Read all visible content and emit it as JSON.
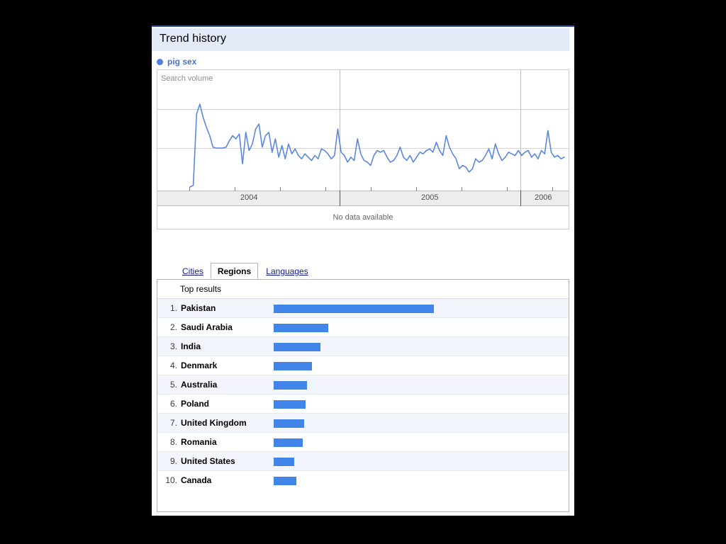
{
  "header": {
    "title": "Trend history"
  },
  "legend": {
    "dot_icon": "legend-dot-icon",
    "label": "pig sex",
    "color": "#4f7fe0"
  },
  "chart_panel": {
    "ylabel": "Search volume",
    "nodata_text": "No data available"
  },
  "tabs": [
    {
      "label": "Cities",
      "active": false
    },
    {
      "label": "Regions",
      "active": true
    },
    {
      "label": "Languages",
      "active": false
    }
  ],
  "results": {
    "header": "Top results",
    "rows": [
      {
        "rank": "1.",
        "name": "Pakistan",
        "value": 100
      },
      {
        "rank": "2.",
        "name": "Saudi Arabia",
        "value": 34
      },
      {
        "rank": "3.",
        "name": "India",
        "value": 29
      },
      {
        "rank": "4.",
        "name": "Denmark",
        "value": 24
      },
      {
        "rank": "5.",
        "name": "Australia",
        "value": 21
      },
      {
        "rank": "6.",
        "name": "Poland",
        "value": 20
      },
      {
        "rank": "7.",
        "name": "United Kingdom",
        "value": 19
      },
      {
        "rank": "8.",
        "name": "Romania",
        "value": 18
      },
      {
        "rank": "9.",
        "name": "United States",
        "value": 13
      },
      {
        "rank": "10.",
        "name": "Canada",
        "value": 14
      }
    ]
  },
  "chart_data": {
    "type": "line",
    "title": "Trend history",
    "xlabel": "",
    "ylabel": "Search volume",
    "series": [
      {
        "name": "pig sex",
        "color": "#5b87e0",
        "values": [
          0,
          2,
          88,
          100,
          84,
          72,
          62,
          48,
          47,
          47,
          47,
          48,
          56,
          62,
          58,
          64,
          28,
          66,
          44,
          52,
          70,
          76,
          48,
          62,
          66,
          42,
          58,
          36,
          50,
          34,
          52,
          40,
          46,
          38,
          34,
          40,
          36,
          32,
          38,
          34,
          46,
          44,
          40,
          34,
          38,
          70,
          42,
          38,
          30,
          36,
          32,
          58,
          40,
          32,
          30,
          26,
          38,
          44,
          42,
          44,
          36,
          30,
          32,
          38,
          48,
          36,
          32,
          38,
          30,
          36,
          42,
          40,
          44,
          46,
          42,
          54,
          44,
          38,
          62,
          48,
          40,
          34,
          22,
          26,
          24,
          18,
          22,
          34,
          30,
          32,
          38,
          46,
          34,
          52,
          40,
          32,
          36,
          42,
          40,
          38,
          44,
          38,
          42,
          44,
          36,
          40,
          34,
          44,
          40,
          68,
          42,
          36,
          38,
          34,
          36
        ]
      }
    ],
    "xticks": [
      "2004",
      "2005",
      "2006"
    ],
    "grid": true,
    "legend_position": "top-left"
  },
  "colors": {
    "accent_blue": "#4285e8",
    "line_blue": "#5b87e0",
    "header_band": "#e3ebf8",
    "page_border_top": "#3b5998",
    "row_alt": "#f2f5fc",
    "tab_link": "#11198c"
  }
}
